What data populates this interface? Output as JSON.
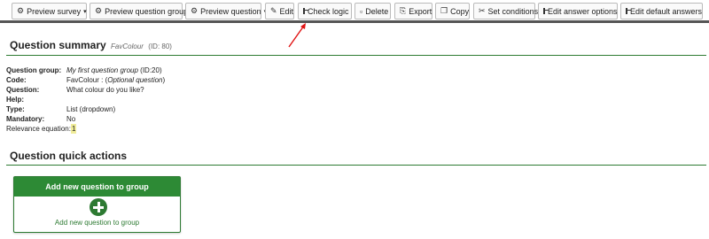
{
  "toolbar": {
    "preview_survey": "Preview survey",
    "preview_group": "Preview question group",
    "preview_question": "Preview question",
    "edit": "Edit",
    "check_logic": "Check logic",
    "delete": "Delete",
    "export": "Export",
    "copy": "Copy",
    "set_conditions": "Set conditions",
    "edit_answer_options": "Edit answer options",
    "edit_default_answers": "Edit default answers"
  },
  "summary": {
    "title": "Question summary",
    "code": "FavColour",
    "id_text": "(ID: 80)",
    "rows": [
      {
        "key": "Question group:",
        "value_italic": "My first question group",
        "value": " (ID:20)"
      },
      {
        "key": "Code:",
        "value": "FavColour : (",
        "value_italic": "Optional question",
        "value_end": ")"
      },
      {
        "key": "Question:",
        "value": "What colour do you like?"
      },
      {
        "key": "Help:",
        "value": ""
      },
      {
        "key": "Type:",
        "value": "List (dropdown)"
      },
      {
        "key": "Mandatory:",
        "value": "No"
      }
    ],
    "relevance_label": "Relevance equation:",
    "relevance_value": "1"
  },
  "quick_actions": {
    "title": "Question quick actions",
    "card_header": "Add new question to group",
    "card_link": "Add new question to group"
  },
  "colors": {
    "accent_green": "#2d7a32",
    "card_header_green": "#2d8a35",
    "annotation_arrow": "#e01010"
  }
}
